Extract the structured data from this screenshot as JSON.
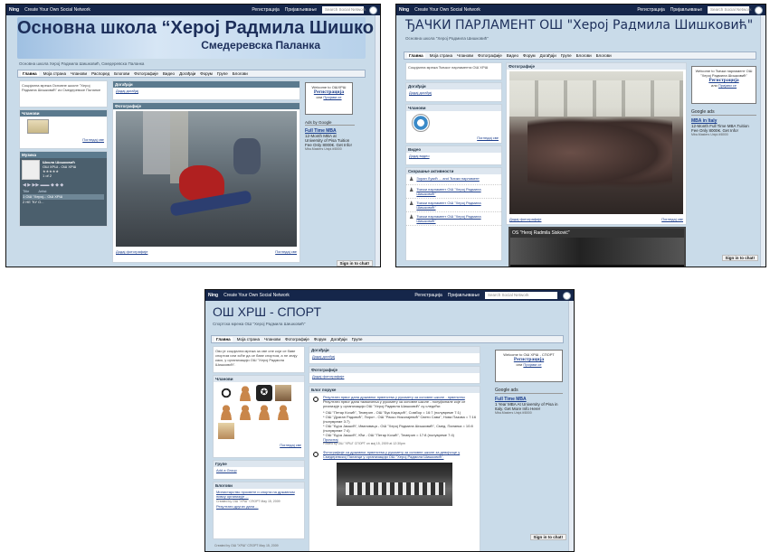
{
  "common": {
    "ning": "Ning",
    "network_label": "Create Your Own Social Network",
    "register": "Регистрација",
    "login": "Пријављивање",
    "search_placeholder": "Search Social Network",
    "sign_in_chat": "Sign in to chat!",
    "see_all": "Погледај све"
  },
  "shot1": {
    "title": "Основна школа “Херој Радмила Шишковић”",
    "subtitle": "Смедеревска Паланка",
    "tagline": "Основна школа Херој Радмила Шишковић, Смедеревска Паланка",
    "nav": [
      "Главна",
      "Моја страна",
      "Чланови",
      "Распоред",
      "Блогови",
      "Фотографије",
      "Видео",
      "Догађаји",
      "Форум",
      "Групе",
      "Блогови"
    ],
    "about_text": "Социјална мрежа Основне школе \"Херој Радмила Шишковић\" из Смедеревске Паланке",
    "events_head": "Догађаји",
    "add_event": "Додај догађај",
    "photos_head": "Фотографије",
    "members_head": "Чланови",
    "music_head": "Музика",
    "music_title": "Школа Шишковић",
    "music_by": "ОШ ХРШ - ОШ ХРШ",
    "music_count": "1 of 2",
    "music_col": "Title",
    "music_artist": "Artist",
    "tracks": [
      "1  ОШ \"Херој...   ОШ ХРШ",
      "2  НЕ ЋУ О..."
    ],
    "add_photos": "Додај фотографије",
    "welcome": "Welcome to ОШХРШ",
    "or": "или",
    "login_link": "Пријави се",
    "ads_by": "Ads by Google",
    "ad_title": "Full Time MBA",
    "ad_body": "12-Month MBA at University of Pisa Tuition Fee Only 8000€. Get Info!",
    "ad_url": "Mba.Masters Unipi.it/8000"
  },
  "shot2": {
    "title": "ЂАЧКИ ПАРЛАМЕНТ ОШ \"Херој Радмила Шишковић\"",
    "tagline": "Основна школа \"Херој Радмила Шишковић\"",
    "nav": [
      "Главна",
      "Моја страна",
      "Чланови",
      "Фотографије",
      "Видео",
      "Форум",
      "Догађаји",
      "Групе",
      "Блогови",
      "Блогови"
    ],
    "about_text": "Социјална мрежа Ђачког парламента ОШ ХРШ",
    "events_head": "Догађаји",
    "add_event": "Додај догађај",
    "members_head": "Чланови",
    "video_head": "Видео",
    "add_video": "Додај видео",
    "activity_head": "Скорашње активности",
    "activity": [
      "Зоран Лукић ... and Ђачки парламент",
      "Ђачки парламент ОШ \"Херој Радмила Шишковић\"",
      "Ђачки парламент ОШ \"Херој Радмила Шишковић\"",
      "Ђачки парламент ОШ \"Херој Радмила Шишковић\""
    ],
    "photos_head": "Фотографије",
    "add_photos": "Додај фотографије",
    "video_label": "OS \"Heroj Radmila Sisković\"",
    "welcome": "Welcome to Ђачки парламент ОШ \"Херој Радмила Шишковић\"",
    "or": "или",
    "login_link": "Пријави се",
    "ads_by": "Google ads",
    "ad_title": "MBA in Italy",
    "ad_body": "12-Month Full Time MBA Tuition Fee Only 8000€. Get Info!",
    "ad_url": "Mba.Masters Unipi.it/8000"
  },
  "shot3": {
    "title": "ОШ ХРШ - СПОРТ",
    "tagline": "Спортска мрежа ОШ \"Херој Радмила Шишковић\"",
    "nav": [
      "Главна",
      "Моја страна",
      "Чланови",
      "Фотографије",
      "Форум",
      "Догађаји",
      "Групе"
    ],
    "about_text": "Ово је социјална мрежа за све оне који се баве спортом или хоће да се баве спортом, а не знају како, у организацији ОШ \"Херој Радмила Шишковић\".",
    "members_head": "Чланови",
    "groups_head": "Групе",
    "add_group": "Add a Group",
    "blogs_head": "Блогови",
    "blog_left": [
      "Министарство просвете и спорта на државном нивоу организује ...",
      "Резултати других дана ..."
    ],
    "blog_meta": "Created by ОШ \"ХРШ\" СПОРТ May 15, 2009",
    "events_head": "Догађаји",
    "add_event": "Додај догађај",
    "photos_head": "Фотографије",
    "add_photos": "Додај фотографије",
    "blog_head": "Блог поруке",
    "post1_title": "Резултати првог дана државног првенства у рукомету за основне школе - првенство",
    "post1_body": "Резултати првог дана такмичења у рукомету за основне школе - полуфинале које се реализује у организацији ОШ \"Херој Радмила Шишковић\" су следећи:",
    "results": [
      "* ОШ \"Петар Кочић\", Темерин - ОШ \"Бук Караџић\", Сомбор = 16:7 (полувреме 7:1)",
      "* ОШ \"Драган Радовић\", Пирот - ОШ \"Раско Николајевић\" Свети Сава\", Нова Пазова = 7:16 (полувреме 3:7)",
      "* ОШ \"Бура Јакшић\", Ивановица - ОШ \"Херој Радмила Шишковић\", Смед. Паланка = 10:8 (полувреме 7:4)",
      "* ОШ \"Бура Јакшић\", Кћи - ОШ \"Петар Кочић\", Темерин = 17:8 (полувреме 7:4)"
    ],
    "post1_more": "Прочитај",
    "post1_meta": "Posted by ОШ \"ХРШ\" СПОРТ on мај 15, 2009 at 12:30pm",
    "post2_title": "Фотографије са државног првенства у рукомету за основне школе за девојчице у Смедеревској Паланци у организацији ОШ \"Херој Радмила Шишковић\".",
    "welcome": "Welcome to ОШ ХРШ - СПОРТ",
    "or": "или",
    "login_link": "Пријави се",
    "ads_by": "Google ads",
    "ad_title": "Full Time MBA",
    "ad_body": "1 Year MBA At University of Pisa in Italy. Get More Info Here!",
    "ad_url": "Mba.Masters Unipi.it/8000"
  }
}
